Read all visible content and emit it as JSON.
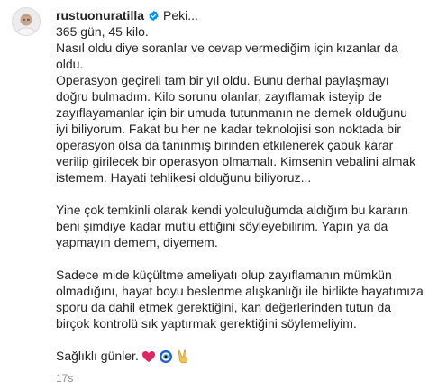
{
  "post": {
    "username": "rustuonuratilla",
    "header_text": "Peki...",
    "lines": {
      "l1": "365 gün, 45 kilo.",
      "l2": "Nasıl oldu diye soranlar ve cevap vermediğim için kızanlar da",
      "l3": "oldu.",
      "l4": "Operasyon geçireli tam bir yıl oldu. Bunu derhal paylaşmayı",
      "l5": "doğru bulmadım. Kilo sorunu olanlar, zayıflamak isteyip de",
      "l6": "zayıflayamanlar için bir umuda tutunmanın ne demek olduğunu",
      "l7": "iyi biliyorum. Fakat bu her ne kadar teknolojisi son noktada bir",
      "l8": "operasyon olsa da tanınmış birinden etkilenerek çabuk karar",
      "l9": "verilip girilecek bir operasyon olmamalı. Kimsenin vebalini almak",
      "l10": "istemem. Hayati tehlikesi olduğunu biliyoruz...",
      "l11": "Yine çok temkinli olarak kendi yolculuğumda aldığım bu kararın",
      "l12": "beni şimdiye kadar mutlu ettiğini söyleyebilirim. Yapın ya da",
      "l13": "yapmayın demem, diyemem.",
      "l14": "Sadece mide küçültme ameliyatı olup zayıflamanın mümkün",
      "l15": "olmadığını, hayat boyu beslenme alışkanlığı ile birlikte hayatımıza",
      "l16": "sporu da dahil etmek gerektiğini, kan değerlerinden tutun da",
      "l17": "birçok kontrolü sık yaptırmak gerektiğini söylemeliyim.",
      "l18": "Sağlıklı günler."
    },
    "emojis": [
      "red-heart",
      "nazar-amulet",
      "victory-hand"
    ],
    "timestamp": "17s",
    "colors": {
      "text": "#262626",
      "verified": "#0095f6",
      "timestamp": "#8e8e8e",
      "heart": "#e0245e",
      "nazar": "#1f5fc9",
      "victory": "#f5c24a"
    }
  }
}
